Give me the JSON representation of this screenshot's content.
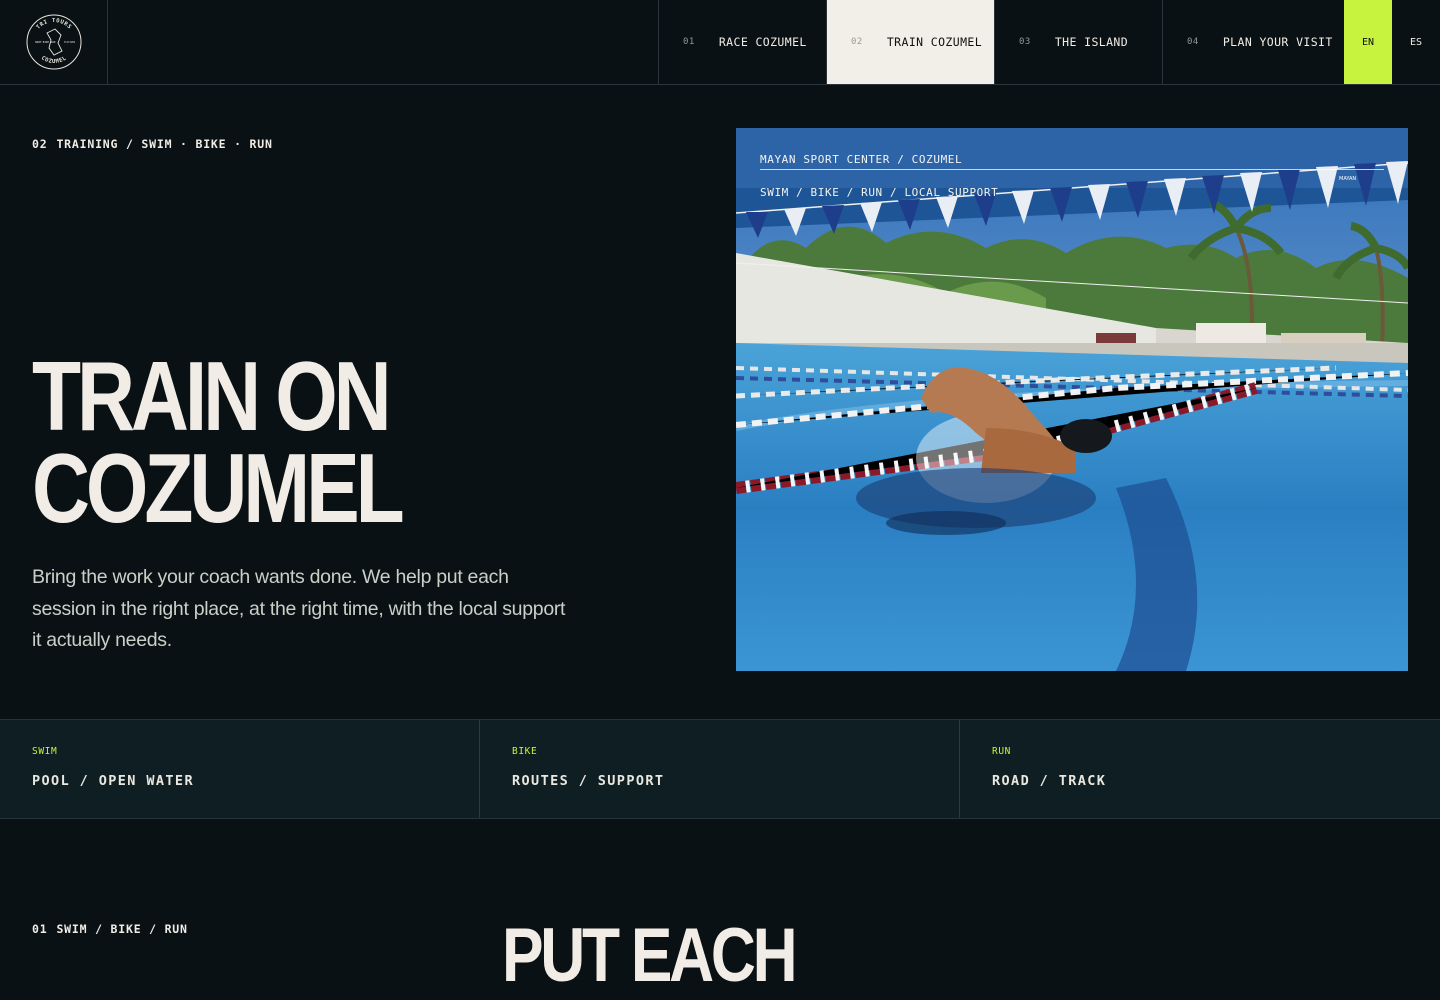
{
  "brand": {
    "logo_top": "TRI TOURS",
    "logo_bottom": "COZUMEL",
    "logo_left": "SWIM BIKE RUN",
    "logo_right": "EST 2024 TRIATHLON"
  },
  "nav": {
    "items": [
      {
        "num": "01",
        "label": "RACE COZUMEL"
      },
      {
        "num": "02",
        "label": "TRAIN COZUMEL"
      },
      {
        "num": "03",
        "label": "THE ISLAND"
      },
      {
        "num": "04",
        "label": "PLAN YOUR VISIT"
      }
    ],
    "active_index": 1,
    "lang_en": "EN",
    "lang_es": "ES"
  },
  "hero": {
    "eyebrow_num": "02",
    "eyebrow_text": "TRAINING / SWIM · BIKE · RUN",
    "title_line1": "TRAIN ON",
    "title_line2": "COZUMEL",
    "body": "Bring the work your coach wants done. We help put each session in the right place, at the right time, with the local support it actually needs.",
    "photo_caption1": "MAYAN SPORT CENTER / COZUMEL",
    "photo_caption2": "SWIM / BIKE / RUN / LOCAL SUPPORT",
    "flag_text": "MAYAN"
  },
  "disciplines": [
    {
      "key": "SWIM",
      "value": "POOL / OPEN WATER"
    },
    {
      "key": "BIKE",
      "value": "ROUTES / SUPPORT"
    },
    {
      "key": "RUN",
      "value": "ROAD / TRACK"
    }
  ],
  "section2": {
    "eyebrow_num": "01",
    "eyebrow_text": "SWIM / BIKE / RUN",
    "title": "PUT EACH"
  },
  "colors": {
    "background": "#0a1114",
    "accent": "#c7f23d",
    "text": "#f1ede6",
    "strip": "#0f1e22"
  }
}
